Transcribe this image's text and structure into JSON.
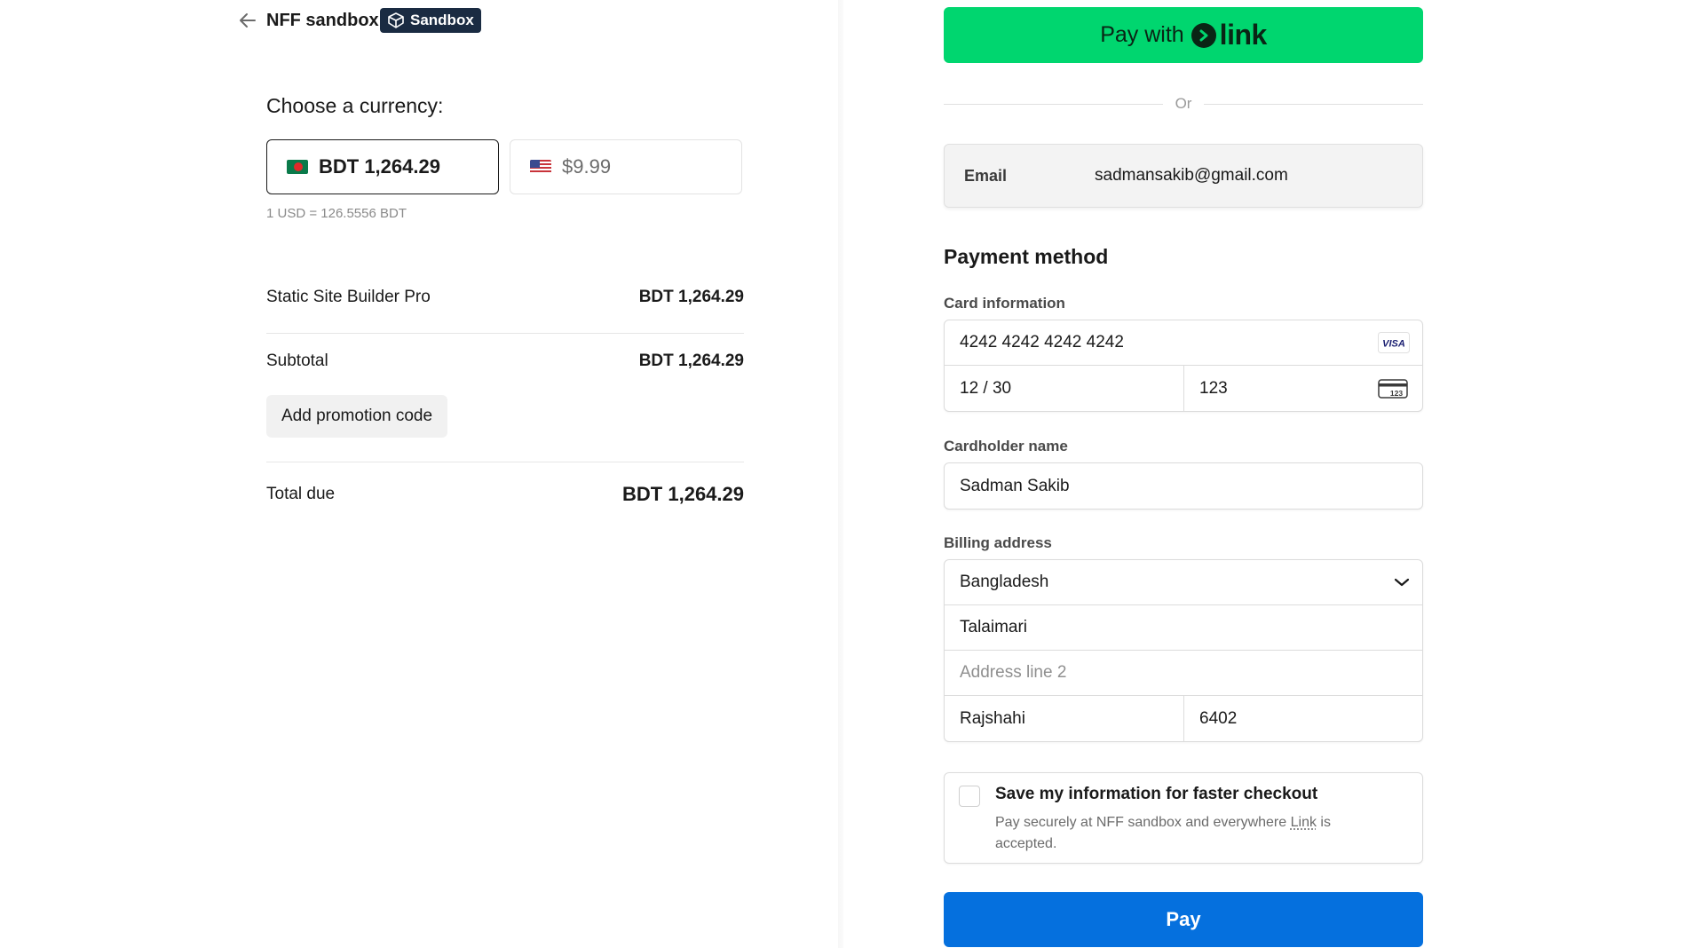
{
  "header": {
    "merchant_name": "NFF sandbox",
    "badge_label": "Sandbox"
  },
  "currency": {
    "heading": "Choose a currency:",
    "options": [
      {
        "flag": "bangladesh-flag",
        "amount": "BDT 1,264.29",
        "selected": true
      },
      {
        "flag": "us-flag",
        "amount": "$9.99",
        "selected": false
      }
    ],
    "rate_text": "1 USD = 126.5556 BDT"
  },
  "summary": {
    "item": {
      "label": "Static Site Builder Pro",
      "amount": "BDT 1,264.29"
    },
    "subtotal": {
      "label": "Subtotal",
      "amount": "BDT 1,264.29"
    },
    "promo_button": "Add promotion code",
    "total": {
      "label": "Total due",
      "amount": "BDT 1,264.29"
    }
  },
  "payment": {
    "link_button": {
      "prefix": "Pay with",
      "brand": "link"
    },
    "or_text": "Or",
    "email": {
      "label": "Email",
      "value": "sadmansakib@gmail.com"
    },
    "section_title": "Payment method",
    "card": {
      "label": "Card information",
      "number": "4242 4242 4242 4242",
      "brand": "VISA",
      "expiry": "12 / 30",
      "cvc": "123",
      "cvc_icon_text": "123"
    },
    "cardholder": {
      "label": "Cardholder name",
      "value": "Sadman Sakib"
    },
    "billing": {
      "label": "Billing address",
      "country": "Bangladesh",
      "line1": "Talaimari",
      "line2_placeholder": "Address line 2",
      "city": "Rajshahi",
      "postal": "6402"
    },
    "save_info": {
      "title": "Save my information for faster checkout",
      "desc_prefix": "Pay securely at NFF sandbox and everywhere ",
      "desc_link": "Link",
      "desc_suffix": " is accepted."
    },
    "pay_button": "Pay"
  },
  "colors": {
    "link_green": "#00d66f",
    "pay_blue": "#0570de",
    "badge_navy": "#1a2b42"
  }
}
